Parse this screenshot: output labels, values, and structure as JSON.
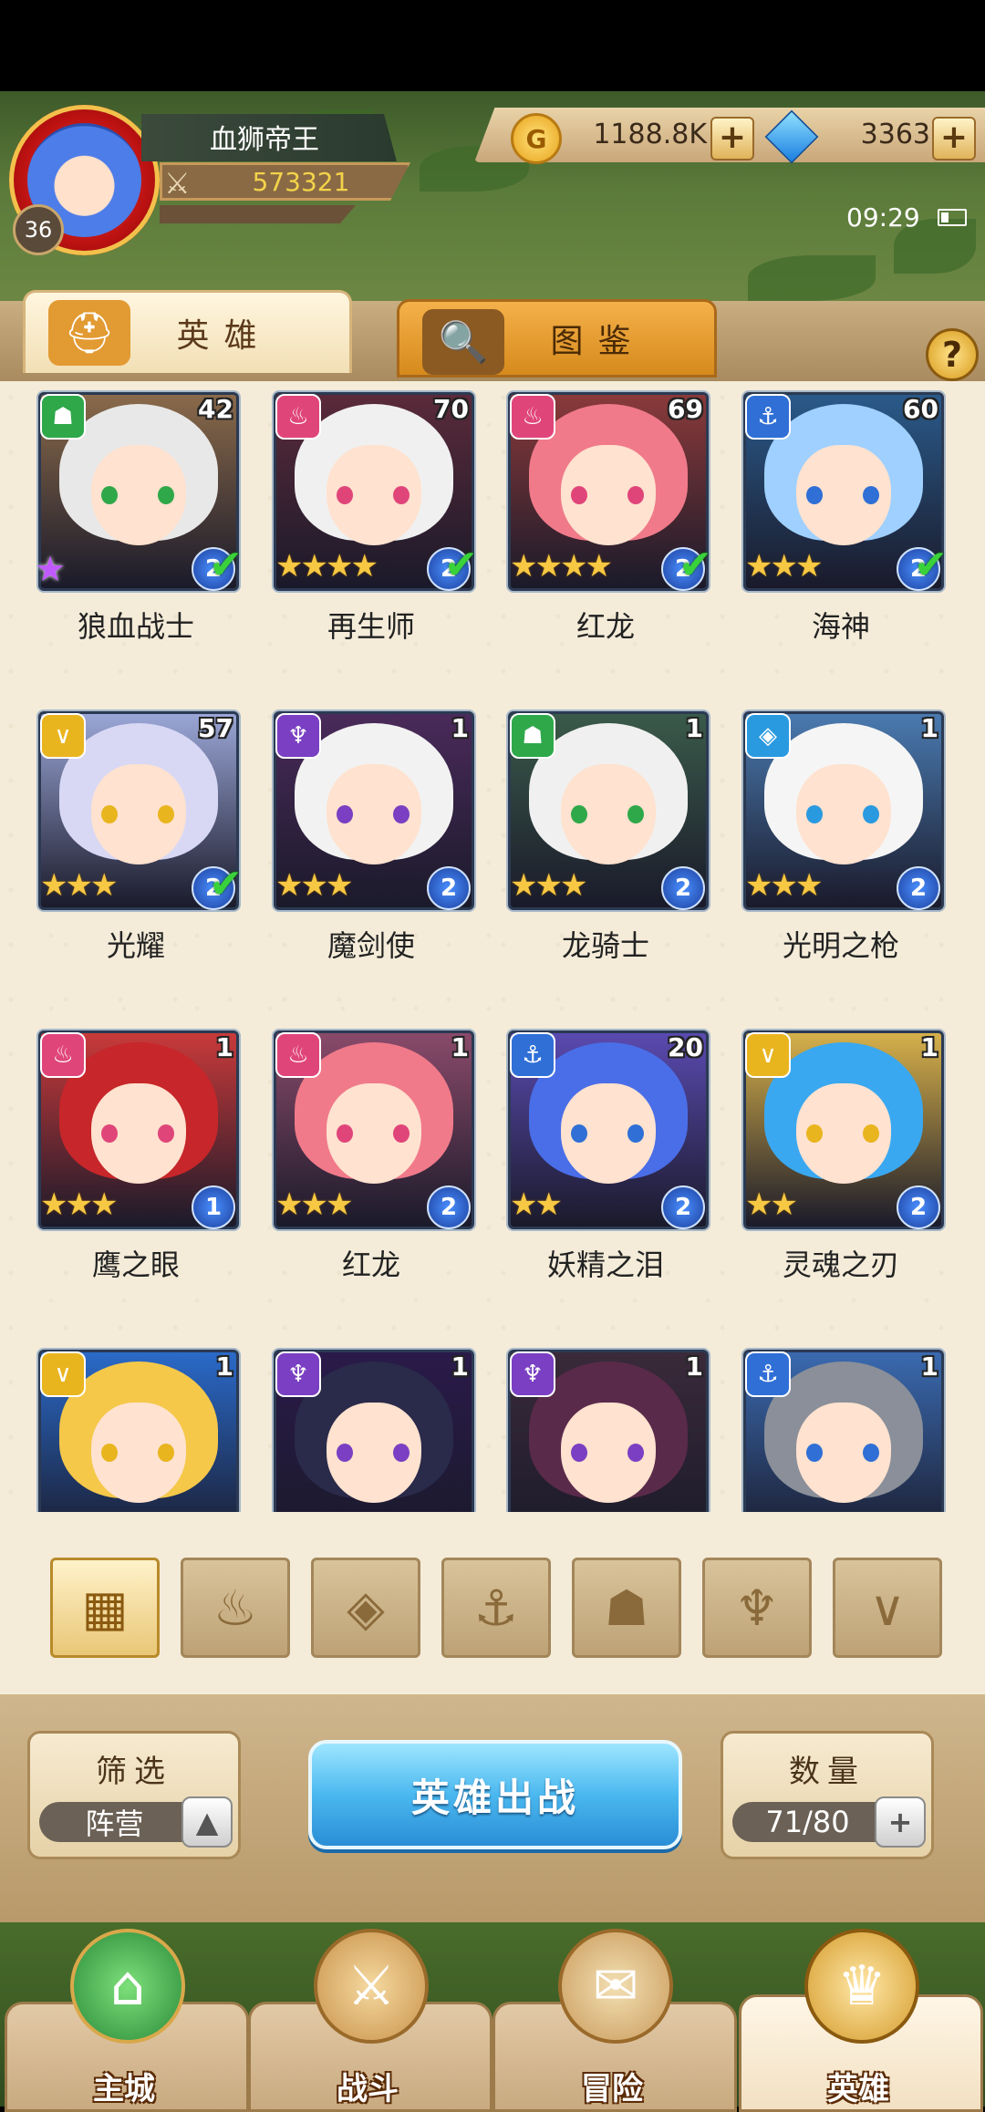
{
  "player": {
    "name": "血狮帝王",
    "level": "36",
    "power": "573321"
  },
  "resources": {
    "gold": "1188.8K",
    "diamonds": "3363"
  },
  "status_bar": {
    "time": "09:29"
  },
  "tabs": [
    {
      "label": "英雄",
      "icon": "helmet-icon",
      "active": true
    },
    {
      "label": "图鉴",
      "icon": "magnifier-icon",
      "active": false
    }
  ],
  "heroes": [
    {
      "name": "狼血战士",
      "level": "42",
      "faction": "beast",
      "stars": 0,
      "rainbow_star": true,
      "rank": "2",
      "owned_check": true
    },
    {
      "name": "再生师",
      "level": "70",
      "faction": "flame",
      "stars": 4,
      "rank": "2",
      "owned_check": true
    },
    {
      "name": "红龙",
      "level": "69",
      "faction": "flame",
      "stars": 4,
      "rank": "2",
      "owned_check": true
    },
    {
      "name": "海神",
      "level": "60",
      "faction": "anchor",
      "stars": 3,
      "rank": "2",
      "owned_check": true
    },
    {
      "name": "光耀",
      "level": "57",
      "faction": "light",
      "stars": 3,
      "rank": "2",
      "owned_check": true
    },
    {
      "name": "魔剑使",
      "level": "1",
      "faction": "dark",
      "stars": 3,
      "rank": "2",
      "owned_check": false
    },
    {
      "name": "龙骑士",
      "level": "1",
      "faction": "beast",
      "stars": 3,
      "rank": "2",
      "owned_check": false
    },
    {
      "name": "光明之枪",
      "level": "1",
      "faction": "crystal",
      "stars": 3,
      "rank": "2",
      "owned_check": false
    },
    {
      "name": "鹰之眼",
      "level": "1",
      "faction": "flame",
      "stars": 3,
      "rank": "1",
      "owned_check": false
    },
    {
      "name": "红龙",
      "level": "1",
      "faction": "flame",
      "stars": 3,
      "rank": "2",
      "owned_check": false
    },
    {
      "name": "妖精之泪",
      "level": "20",
      "faction": "anchor",
      "stars": 2,
      "rank": "2",
      "owned_check": false
    },
    {
      "name": "灵魂之刃",
      "level": "1",
      "faction": "light",
      "stars": 2,
      "rank": "2",
      "owned_check": false
    },
    {
      "name": "",
      "level": "1",
      "faction": "light",
      "stars": 0,
      "rank": "",
      "owned_check": false
    },
    {
      "name": "",
      "level": "1",
      "faction": "dark",
      "stars": 0,
      "rank": "",
      "owned_check": false
    },
    {
      "name": "",
      "level": "1",
      "faction": "dark",
      "stars": 0,
      "rank": "",
      "owned_check": false
    },
    {
      "name": "",
      "level": "1",
      "faction": "anchor",
      "stars": 0,
      "rank": "",
      "owned_check": false
    }
  ],
  "faction_filters": [
    {
      "name": "all",
      "icon": "grid-icon",
      "active": true
    },
    {
      "name": "flame",
      "icon": "flame-icon",
      "active": false
    },
    {
      "name": "crystal",
      "icon": "crystal-icon",
      "active": false
    },
    {
      "name": "anchor",
      "icon": "anchor-icon",
      "active": false
    },
    {
      "name": "beast",
      "icon": "beast-icon",
      "active": false
    },
    {
      "name": "dark",
      "icon": "dark-horn-icon",
      "active": false
    },
    {
      "name": "light",
      "icon": "light-wing-icon",
      "active": false
    }
  ],
  "filter_panel": {
    "label": "筛选",
    "value": "阵营"
  },
  "deploy_button": {
    "label": "英雄出战"
  },
  "count_panel": {
    "label": "数量",
    "value": "71/80"
  },
  "bottom_nav": [
    {
      "label": "主城",
      "icon": "castle-icon",
      "active": false
    },
    {
      "label": "战斗",
      "icon": "crossed-swords-icon",
      "active": false
    },
    {
      "label": "冒险",
      "icon": "scroll-map-icon",
      "active": false
    },
    {
      "label": "英雄",
      "icon": "hero-helmet-icon",
      "active": true
    }
  ],
  "colors": {
    "panel_bg": "#f4ecd9",
    "faction_flame": "#e0457a",
    "faction_anchor": "#2f6fd6",
    "faction_beast": "#2fa84a",
    "faction_light": "#e9b51f",
    "faction_dark": "#7a3fc2",
    "faction_crystal": "#2a9ae0",
    "deploy_button": "#4bb8ef"
  }
}
